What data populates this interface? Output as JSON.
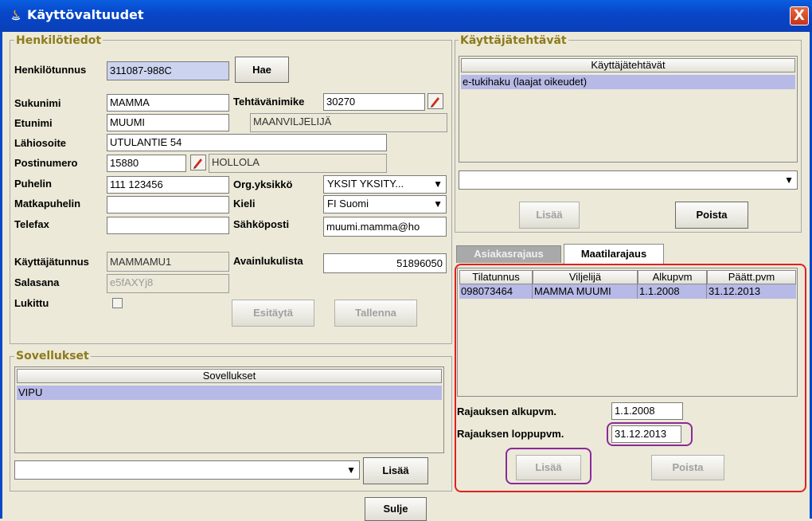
{
  "window": {
    "title": "Käyttövaltuudet",
    "close": "X"
  },
  "henkilotiedot": {
    "group_label": "Henkilötiedot",
    "henkilotunnus": {
      "label": "Henkilötunnus",
      "value": "311087-988C"
    },
    "hae": "Hae",
    "sukunimi": {
      "label": "Sukunimi",
      "value": "MAMMA"
    },
    "tehtavanimike": {
      "label": "Tehtävänimike",
      "value": "30270"
    },
    "etunimi": {
      "label": "Etunimi",
      "value": "MUUMI"
    },
    "tehtava_text": "MAANVILJELIJÄ",
    "lahiosoite": {
      "label": "Lähiosoite",
      "value": "UTULANTIE 54"
    },
    "postinumero": {
      "label": "Postinumero",
      "value": "15880"
    },
    "postitoimipaikka": "HOLLOLA",
    "puhelin": {
      "label": "Puhelin",
      "value": "111 123456"
    },
    "orgyksikko": {
      "label": "Org.yksikkö",
      "value": "YKSIT  YKSITY..."
    },
    "matkapuhelin": {
      "label": "Matkapuhelin",
      "value": ""
    },
    "kieli": {
      "label": "Kieli",
      "value": "FI  Suomi"
    },
    "telefax": {
      "label": "Telefax",
      "value": ""
    },
    "sahkoposti": {
      "label": "Sähköposti",
      "value": "muumi.mamma@ho"
    },
    "kayttajatunnus": {
      "label": "Käyttäjätunnus",
      "value": "MAMMAMU1"
    },
    "avainlukulista": {
      "label": "Avainlukulista",
      "value": "51896050"
    },
    "salasana": {
      "label": "Salasana",
      "value": "e5fAXYj8"
    },
    "lukittu": {
      "label": "Lukittu",
      "checked": false
    },
    "esitayta": "Esitäytä",
    "tallenna": "Tallenna"
  },
  "sovellukset": {
    "group_label": "Sovellukset",
    "header": "Sovellukset",
    "rows": [
      "VIPU"
    ],
    "combo_value": "",
    "lisaa": "Lisää"
  },
  "kayttajatehtavat": {
    "group_label": "Käyttäjätehtävät",
    "header": "Käyttäjätehtävät",
    "rows": [
      "e-tukihaku (laajat oikeudet)"
    ],
    "combo_value": "",
    "lisaa": "Lisää",
    "poista": "Poista"
  },
  "tabs": [
    {
      "label": "Asiakasrajaus",
      "active": false
    },
    {
      "label": "Maatilarajaus",
      "active": true
    }
  ],
  "maatila_table": {
    "columns": [
      "Tilatunnus",
      "Viljelijä",
      "Alkupvm",
      "Päätt.pvm"
    ],
    "rows": [
      [
        "098073464",
        "MAMMA MUUMI",
        "1.1.2008",
        "31.12.2013"
      ]
    ]
  },
  "rajaus": {
    "alku_label": "Rajauksen alkupvm.",
    "alku_value": "1.1.2008",
    "loppu_label": "Rajauksen loppupvm.",
    "loppu_value": "31.12.2013",
    "lisaa": "Lisää",
    "poista": "Poista"
  },
  "sulje": "Sulje",
  "colors": {
    "highlight_red": "#e02020",
    "highlight_purple": "#8a2a9a",
    "selection": "#b7b9e6",
    "group_label": "#8c7b1c"
  }
}
